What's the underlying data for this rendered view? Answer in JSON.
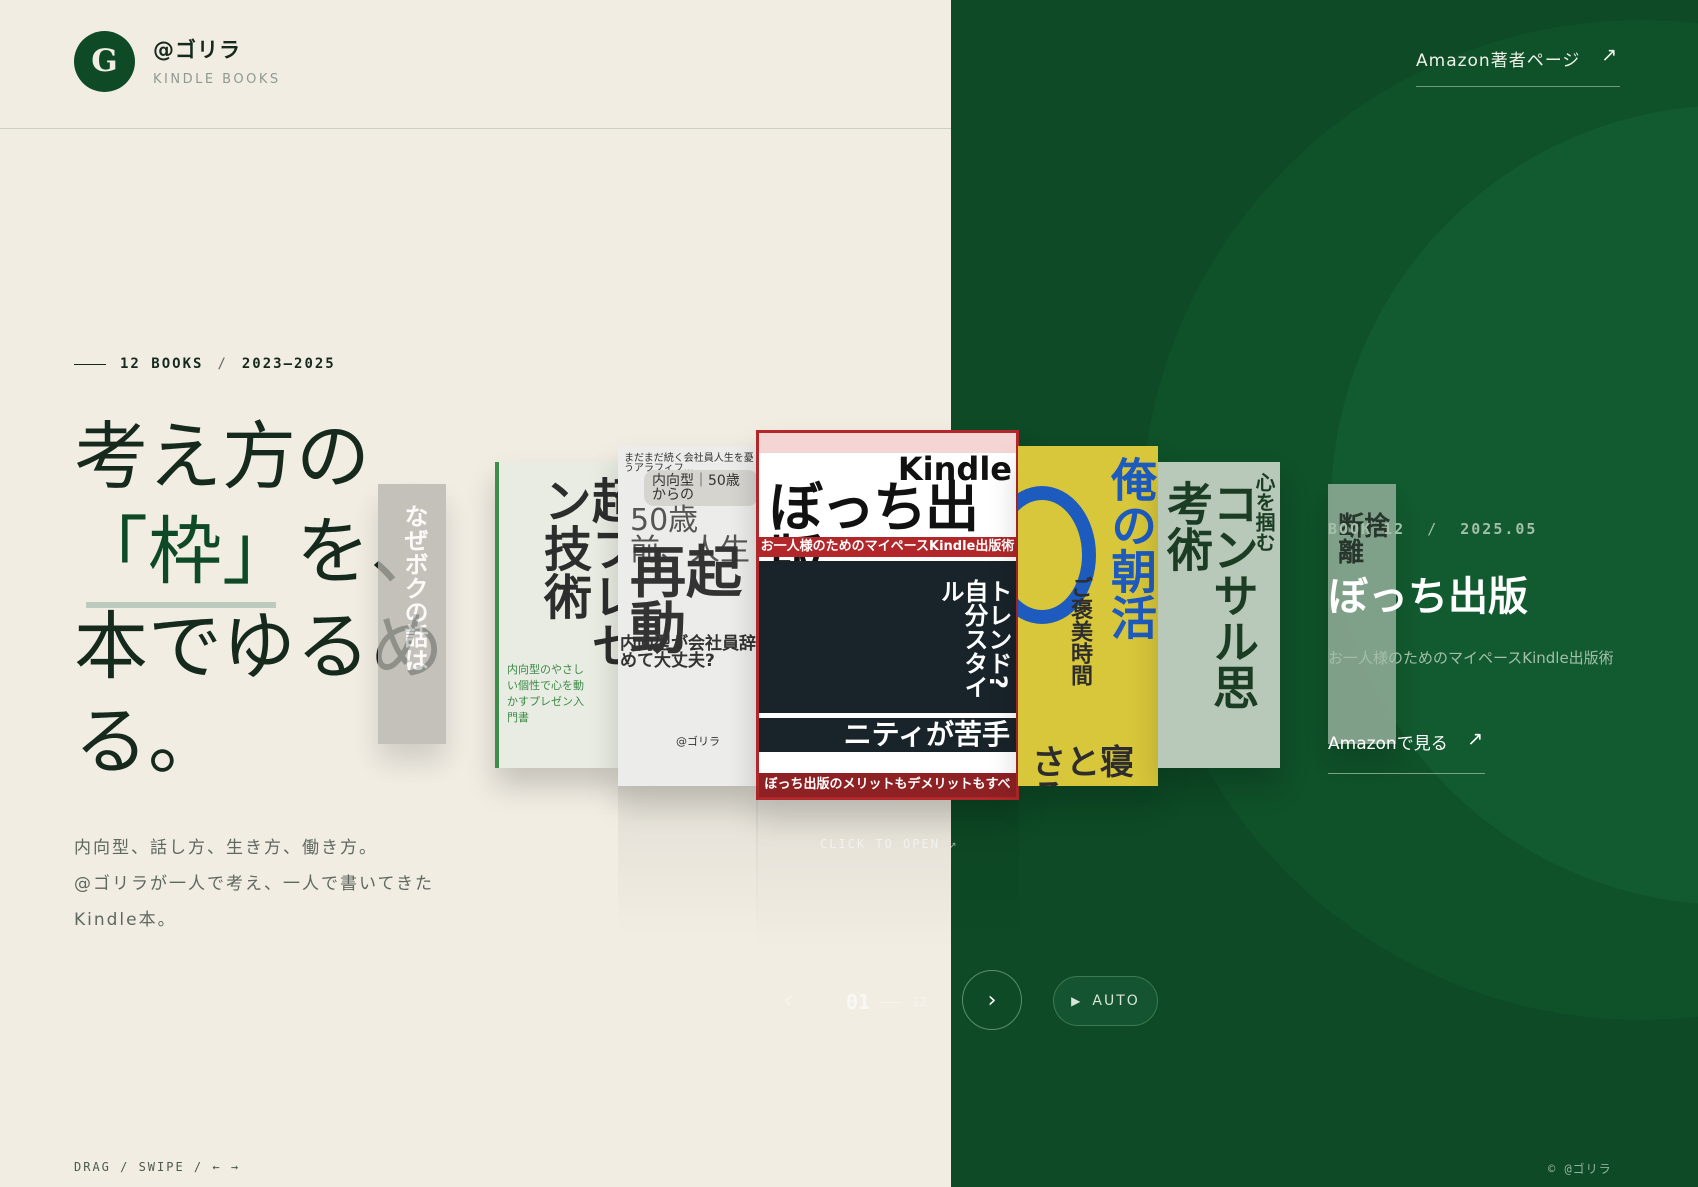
{
  "header": {
    "logo_letter": "G",
    "brand_name": "@ゴリラ",
    "brand_sub": "KINDLE BOOKS",
    "author_link": "Amazon著者ページ",
    "author_link_arrow": "↗"
  },
  "hero": {
    "count": "12 BOOKS",
    "separator": "/",
    "years": "2023–2025",
    "headline_line1": "考え方の",
    "headline_accent": "「枠」",
    "headline_line2_rest": "を、",
    "headline_line3": "本でゆるめ",
    "headline_line4": "る。",
    "intro_line1": "内向型、話し方、生き方、働き方。",
    "intro_line2": "@ゴリラが一人で考え、一人で書いてきた",
    "intro_line3": "Kindle本。"
  },
  "carousel": {
    "books": [
      {
        "title": "なぜボクの話は伝わらないのか?",
        "color": "#b6b3ad"
      },
      {
        "title": "超プレゼン技術",
        "color": "#e9ece2"
      },
      {
        "title": "50歳前、人生再起動",
        "color": "#ececea"
      },
      {
        "title": "ぼっち出版",
        "color": "#ffffff",
        "active": true
      },
      {
        "title": "俺の朝活",
        "color": "#d8c73a"
      },
      {
        "title": "コンサル思考術",
        "color": "#b8c8b9"
      },
      {
        "title": "断捨離",
        "color": "#9cb3a0"
      }
    ],
    "b0_text": "なぜボクの話は",
    "b1_text": "超プレゼン技術",
    "b1_small": "内向型のやさしい個性で心を動かすプレゼン入門書",
    "b2_top": "まだまだ続く会社員人生を憂うアラフィフ…",
    "b2_badge": "内向型｜50歳からの",
    "b2_mid": "50歳前、人生",
    "b2_big": "再起動",
    "b2_q": "内向型が会社員辞めて大丈夫?",
    "b2_author": "@ゴリラ",
    "b3_kindle": "Kindle",
    "b3_title": "ぼっち出版",
    "b3_sub": "お一人様のためのマイペースKindle出版術",
    "b3_side": "トレンド?自分スタイル",
    "b3_bottom": "ニティが苦手",
    "b3_foot": "ぼっち出版のメリットもデメリットもすべて公開",
    "b4_big": "俺の朝活",
    "b4_small": "ご褒美時間",
    "b4_foot": "さと寝ろ。",
    "b5_big": "コンサル思考術",
    "b5_small": "心を掴む",
    "b6_text": "断捨離",
    "click_to_open": "CLICK TO OPEN ↗"
  },
  "active_book": {
    "label": "BOOK 12",
    "separator": "/",
    "date": "2025.05",
    "title": "ぼっち出版",
    "subtitle": "お一人様のためのマイペースKindle出版術",
    "amazon_link": "Amazonで見る",
    "amazon_arrow": "↗"
  },
  "controls": {
    "prev_icon": "‹",
    "current": "01",
    "total": "12",
    "next_icon": "›",
    "play_icon": "▶",
    "auto_label": "AUTO"
  },
  "footer": {
    "drag_hint": "DRAG / SWIPE / ← →",
    "copyright": "© @ゴリラ"
  },
  "colors": {
    "cream": "#f1ede3",
    "forest": "#0d4a25",
    "ink": "#16291d",
    "active_border": "#b1272a"
  }
}
